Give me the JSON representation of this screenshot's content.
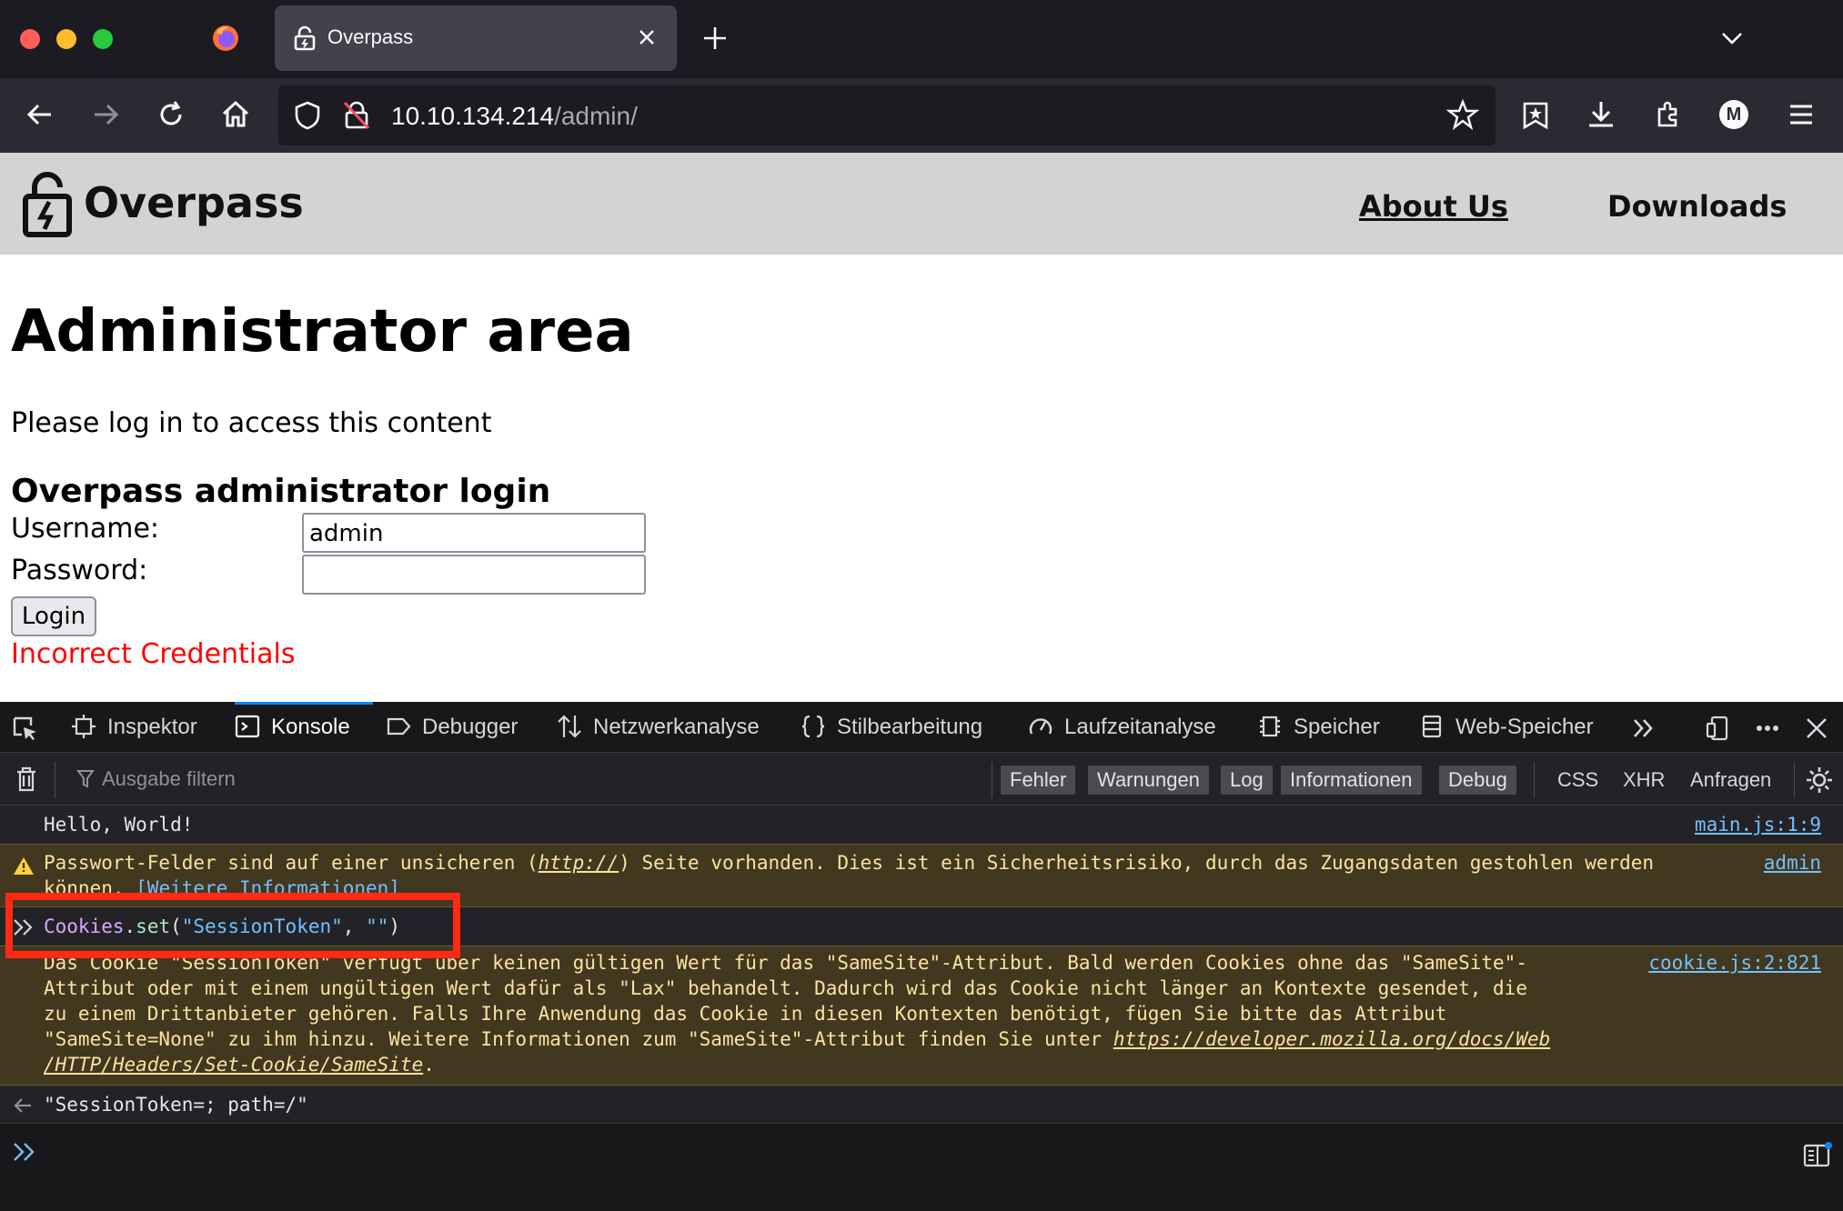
{
  "browser": {
    "tab_title": "Overpass",
    "url_host": "10.10.134.214",
    "url_path": "/admin/",
    "avatar_letter": "M"
  },
  "site": {
    "brand": "Overpass",
    "nav": [
      "About Us",
      "Downloads"
    ],
    "heading": "Administrator area",
    "intro": "Please log in to access this content",
    "login_heading": "Overpass administrator login",
    "username_label": "Username:",
    "username_value": "admin",
    "password_label": "Password:",
    "password_value": "",
    "login_button": "Login",
    "error": "Incorrect Credentials"
  },
  "devtools": {
    "tabs": [
      "Inspektor",
      "Konsole",
      "Debugger",
      "Netzwerkanalyse",
      "Stilbearbeitung",
      "Laufzeitanalyse",
      "Speicher",
      "Web-Speicher"
    ],
    "active_tab": "Konsole",
    "filter_placeholder": "Ausgabe filtern",
    "level_filters": [
      "Fehler",
      "Warnungen",
      "Log",
      "Informationen",
      "Debug"
    ],
    "type_filters": [
      "CSS",
      "XHR",
      "Anfragen"
    ],
    "console": {
      "log1": {
        "text": "Hello, World!",
        "source": "main.js:1:9"
      },
      "warn1": {
        "line1_a": "Passwort-Felder sind auf einer unsicheren (",
        "line1_link": "http://",
        "line1_b": ") Seite vorhanden. Dies ist ein Sicherheitsrisiko, durch das Zugangsdaten gestohlen werden",
        "line2_a": "können. ",
        "line2_link": "[Weitere Informationen]",
        "source": "admin"
      },
      "input1": {
        "object": "Cookies",
        "dot": ".",
        "method": "set",
        "open": "(",
        "arg1": "\"SessionToken\"",
        "comma": ", ",
        "arg2": "\"\"",
        "close": ")"
      },
      "warn2": {
        "line1": "Das Cookie \"SessionToken\" verfügt über keinen gültigen Wert für das \"SameSite\"-Attribut. Bald werden Cookies ohne das \"SameSite\"-",
        "line2": "Attribut oder mit einem ungültigen Wert dafür als \"Lax\" behandelt. Dadurch wird das Cookie nicht länger an Kontexte gesendet, die",
        "line3": "zu einem Drittanbieter gehören. Falls Ihre Anwendung das Cookie in diesen Kontexten benötigt, fügen Sie bitte das Attribut",
        "line4_a": "\"SameSite=None\" zu ihm hinzu. Weitere Informationen zum \"SameSite\"-Attribut finden Sie unter ",
        "line4_link": "https://developer.mozilla.org/docs/Web",
        "line5_link": "/HTTP/Headers/Set-Cookie/SameSite",
        "line5_b": ".",
        "source": "cookie.js:2:821"
      },
      "result1": "\"SessionToken=; path=/\""
    }
  },
  "colors": {
    "warning_bg": "#42381f",
    "highlight_box": "#ff2a14",
    "error_text": "#ff0000",
    "accent": "#0a84ff"
  }
}
